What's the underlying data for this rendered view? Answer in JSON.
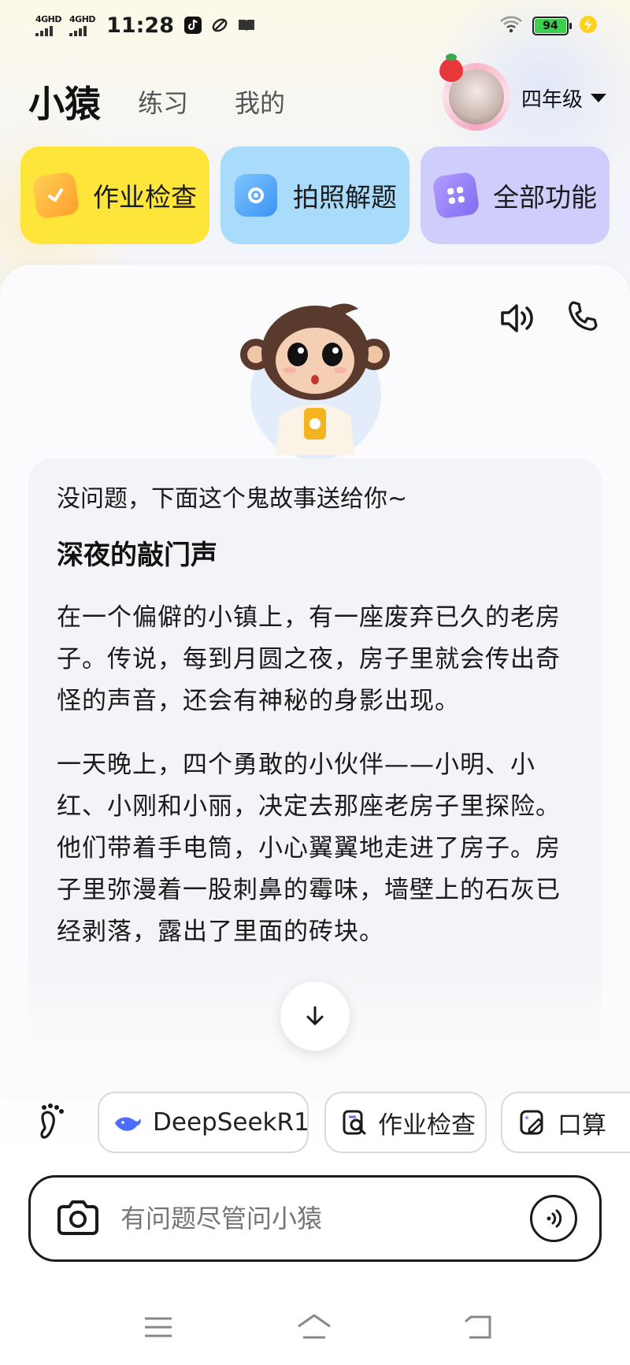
{
  "status_bar": {
    "net1": "4GHD",
    "net2": "4GHD",
    "time": "11:28",
    "battery": "94"
  },
  "header": {
    "brand": "小猿",
    "tabs": [
      "练习",
      "我的"
    ],
    "grade": "四年级"
  },
  "quick_actions": [
    {
      "label": "作业检查"
    },
    {
      "label": "拍照解题"
    },
    {
      "label": "全部功能"
    }
  ],
  "message": {
    "intro": "没问题，下面这个鬼故事送给你~",
    "title": "深夜的敲门声",
    "paragraphs": [
      "在一个偏僻的小镇上，有一座废弃已久的老房子。传说，每到月圆之夜，房子里就会传出奇怪的声音，还会有神秘的身影出现。",
      "一天晚上，四个勇敢的小伙伴——小明、小红、小刚和小丽，决定去那座老房子里探险。他们带着手电筒，小心翼翼地走进了房子。房子里弥漫着一股刺鼻的霉味，墙壁上的石灰已经剥落，露出了里面的砖块。"
    ]
  },
  "chips": [
    {
      "label": "DeepSeekR1",
      "icon": "whale-icon"
    },
    {
      "label": "作业检查",
      "icon": "doc-search-icon"
    },
    {
      "label": "口算",
      "icon": "pencil-card-icon"
    }
  ],
  "input": {
    "placeholder": "有问题尽管问小猿"
  },
  "colors": {
    "yellow_card": "#fde53a",
    "blue_card": "#a9dcfb",
    "purple_card": "#cfcdfb"
  }
}
